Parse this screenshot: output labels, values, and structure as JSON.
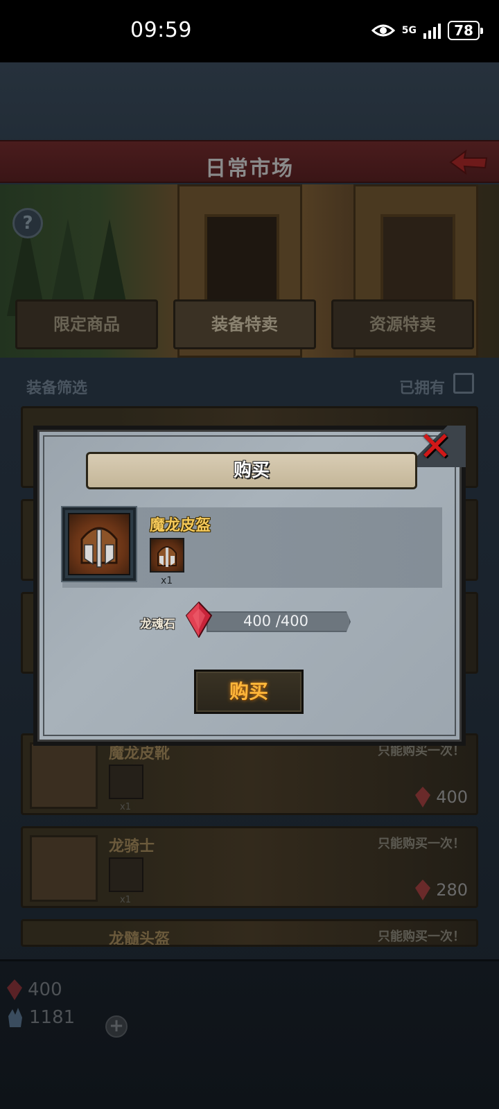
{
  "status_bar": {
    "time": "09:59",
    "network": "5G",
    "battery": "78"
  },
  "header": {
    "title": "日常市场"
  },
  "tabs": [
    {
      "label": "限定商品"
    },
    {
      "label": "装备特卖"
    },
    {
      "label": "资源特卖"
    }
  ],
  "filter": {
    "label": "装备筛选",
    "owned_label": "已拥有"
  },
  "list": [
    {
      "name": "魔龙皮靴",
      "limit": "只能购买一次！",
      "qty": "x1",
      "price": "400"
    },
    {
      "name": "龙骑士",
      "limit": "只能购买一次！",
      "qty": "x1",
      "price": "280"
    },
    {
      "name": "龙髓头盔",
      "limit": "只能购买一次！"
    }
  ],
  "resources": {
    "dragon_soul": "400",
    "crystal": "1181"
  },
  "dialog": {
    "title": "购买",
    "item_name": "魔龙皮盔",
    "item_qty": "x1",
    "cost_label": "龙魂石",
    "cost_value": "400 /400",
    "buy_label": "购买"
  },
  "colors": {
    "accent_gold": "#f5c95a",
    "close_red": "#d01818",
    "gem_red": "#c8243a"
  }
}
